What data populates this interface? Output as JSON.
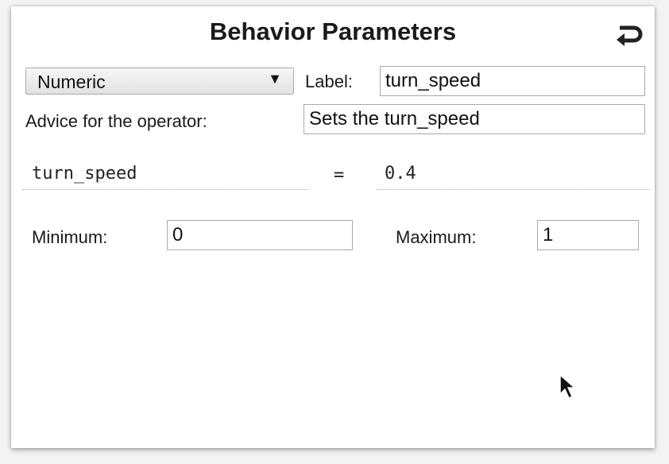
{
  "panel": {
    "title": "Behavior Parameters",
    "back_icon": "undo-arrow-icon"
  },
  "type_select": {
    "selected": "Numeric",
    "arrow": "▼"
  },
  "label_field": {
    "label": "Label:",
    "value": "turn_speed"
  },
  "advice_field": {
    "label": "Advice for the operator:",
    "value": "Sets the turn_speed"
  },
  "parameter": {
    "name": "turn_speed",
    "equals": "=",
    "value": "0.4"
  },
  "range": {
    "min_label": "Minimum:",
    "min_value": "0",
    "max_label": "Maximum:",
    "max_value": "1"
  },
  "mouse": {
    "icon": "mouse-pointer-icon"
  }
}
